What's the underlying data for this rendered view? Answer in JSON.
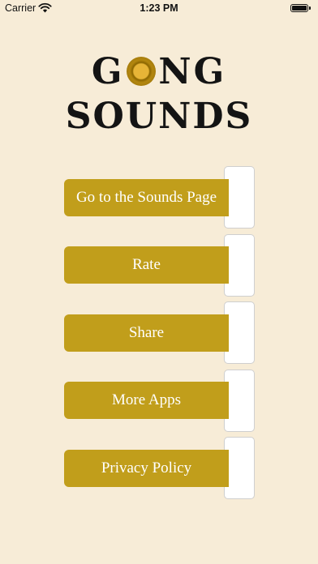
{
  "status_bar": {
    "carrier": "Carrier",
    "time": "1:23 PM",
    "battery_level": 1.0
  },
  "header": {
    "title_line1_prefix": "G",
    "title_line1_suffix": "NG",
    "title_line2": "SOUNDS",
    "logo_icon": "gong-icon"
  },
  "menu": {
    "items": [
      {
        "label": "Go to the Sounds Page"
      },
      {
        "label": "Rate"
      },
      {
        "label": "Share"
      },
      {
        "label": "More Apps"
      },
      {
        "label": "Privacy Policy"
      }
    ]
  },
  "colors": {
    "background": "#f7ecd7",
    "button": "#c19e1b",
    "button_text": "#ffffff",
    "title_text": "#141414"
  }
}
